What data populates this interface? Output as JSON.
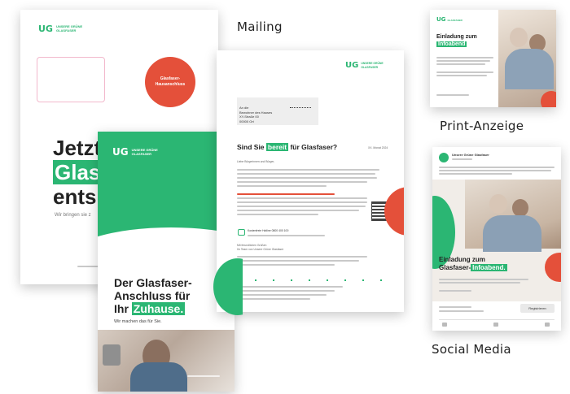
{
  "labels": {
    "mailing": "Mailing",
    "print": "Print-Anzeige",
    "social": "Social Media"
  },
  "brand": {
    "short": "UG",
    "name_line1": "UNSERE GRÜNE",
    "name_line2": "GLASFASER"
  },
  "envelope": {
    "headline_line1": "Jetzt",
    "headline_line2": "Glasf",
    "headline_line3": "ents",
    "badge_line1": "Glasfaser-",
    "badge_line2": "Hausanschluss",
    "subline": "Wir bringen sie z"
  },
  "flyer": {
    "headline_line1": "Der Glasfaser-",
    "headline_line2": "Anschluss für",
    "headline_line3": "Ihr",
    "headline_highlight": "Zuhause.",
    "subline": "Wir machen das für Sie."
  },
  "letter": {
    "recipient_line1": "An die",
    "recipient_line2": "Bewohner des Hauses",
    "recipient_line3": "XY-Straße 00",
    "recipient_line4": "00000 Ort",
    "headline_prefix": "Sind Sie",
    "headline_highlight": "bereit",
    "headline_suffix": "für Glasfaser?",
    "date": "XX. Monat 2024",
    "salutation": "Liebe Bürgerinnen und Bürger,",
    "hotline": "Kostenfreie Hotline 0800 400 100",
    "closing_line1": "Mit freundlichen Grüßen",
    "closing_line2": "Ihr Team von Unsere Grüne Glasfaser"
  },
  "print_ad": {
    "title_line1": "Einladung zum",
    "title_highlight": "Infoabend"
  },
  "social_post": {
    "account": "Unsere Grüne Glasfaser",
    "title_line1": "Einladung zum",
    "title_line2": "Glasfaser-",
    "title_highlight": "Infoabend.",
    "cta": "Registrieren"
  },
  "colors": {
    "brand_green": "#2bb673",
    "accent_orange": "#e4503a"
  }
}
